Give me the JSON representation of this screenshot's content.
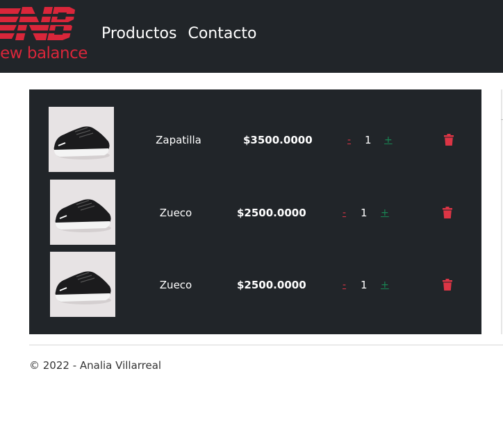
{
  "brand": {
    "name": "new balance",
    "logo_color": "#d9263a"
  },
  "nav": {
    "items": [
      {
        "label": "Productos"
      },
      {
        "label": "Contacto"
      }
    ]
  },
  "cart": {
    "items": [
      {
        "name": "Zapatilla",
        "price": "$3500.0000",
        "quantity": "1",
        "minus": "-",
        "plus": "+",
        "image": "black-sneaker-photo"
      },
      {
        "name": "Zueco",
        "price": "$2500.0000",
        "quantity": "1",
        "minus": "-",
        "plus": "+",
        "image": "black-sneaker-photo"
      },
      {
        "name": "Zueco",
        "price": "$2500.0000",
        "quantity": "1",
        "minus": "-",
        "plus": "+",
        "image": "black-sneaker-photo"
      }
    ],
    "delete_icon": "trash-icon",
    "delete_color": "#dc3545",
    "plus_color": "#198754"
  },
  "footer": {
    "text": "© 2022 - Analia Villarreal"
  }
}
